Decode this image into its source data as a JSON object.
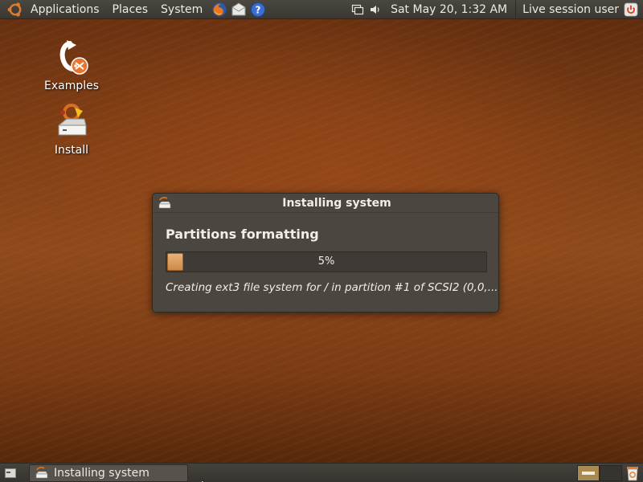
{
  "top_panel": {
    "menus": {
      "applications": "Applications",
      "places": "Places",
      "system": "System"
    },
    "launchers": [
      "firefox-icon",
      "mail-icon",
      "help-icon"
    ],
    "clock": "Sat May 20,  1:32 AM",
    "user": "Live session user"
  },
  "desktop": {
    "icons": [
      {
        "label": "Examples",
        "icon": "examples-icon"
      },
      {
        "label": "Install",
        "icon": "install-icon"
      }
    ]
  },
  "dialog": {
    "title": "Installing system",
    "heading": "Partitions formatting",
    "progress_percent": 5,
    "progress_label": "5%",
    "status": "Creating ext3 file system for / in partition #1 of SCSI2 (0,0,..."
  },
  "bottom_panel": {
    "task_label": "Installing system"
  },
  "colors": {
    "accent": "#d08a48",
    "panel": "#3b3833",
    "dialog_bg": "#4b4640"
  }
}
